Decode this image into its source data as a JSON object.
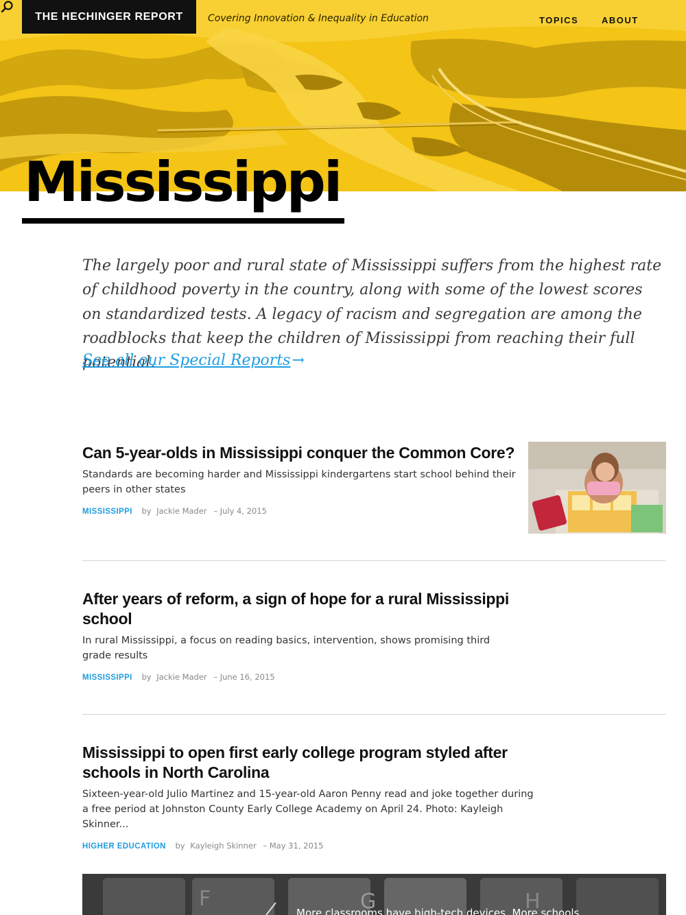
{
  "header": {
    "brand": "THE HECHINGER REPORT",
    "tagline": "Covering Innovation & Inequality in Education",
    "nav": {
      "topics": "TOPICS",
      "about": "ABOUT"
    },
    "accent_color": "#f5c518"
  },
  "page": {
    "title": "Mississippi",
    "intro": "The largely poor and rural state of Mississippi suffers from the highest rate of childhood poverty in the country, along with some of the lowest scores on standardized tests. A legacy of racism and segregation are among the roadblocks that keep the children of Mississippi from reaching their full potential.",
    "special_reports_link": "See all our Special Reports",
    "link_color": "#1e9de0"
  },
  "articles": [
    {
      "title": "Can 5-year-olds in Mississippi conquer the Common Core?",
      "description": "Standards are becoming harder and Mississippi kindergartens start school behind their peers in other states",
      "tag": "MISSISSIPPI",
      "by": "by",
      "author": "Jackie Mader",
      "date": "– July 4, 2015"
    },
    {
      "title": "After years of reform, a sign of hope for a rural Mississippi school",
      "description": "In rural Mississippi, a focus on reading basics, intervention, shows promising third grade results",
      "tag": "MISSISSIPPI",
      "by": "by",
      "author": "Jackie Mader",
      "date": "– June 16, 2015"
    },
    {
      "title": "Mississippi to open first early college program styled after schools in North Carolina",
      "description": "Sixteen-year-old Julio Martinez and 15-year-old Aaron Penny read and joke together during a free period at Johnston County Early College Academy on April 24. Photo: Kayleigh Skinner...",
      "tag": "HIGHER EDUCATION",
      "by": "by",
      "author": "Kayleigh Skinner",
      "date": "– May 31, 2015"
    }
  ],
  "banner": {
    "text": "More classrooms have high-tech devices. More schools"
  }
}
